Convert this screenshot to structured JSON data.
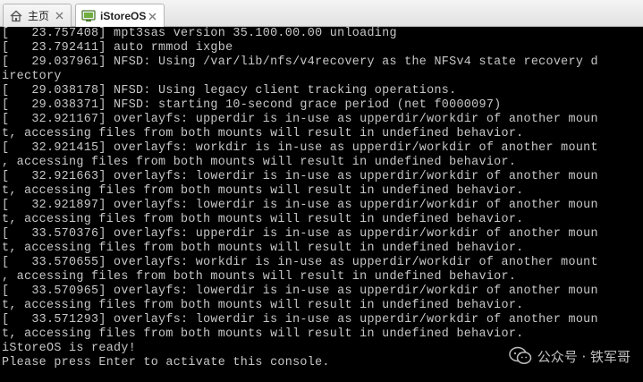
{
  "tabs": [
    {
      "label": "主页",
      "icon": "home-icon",
      "active": false
    },
    {
      "label": "iStoreOS",
      "icon": "vm-console-icon",
      "active": true
    }
  ],
  "console": {
    "lines": [
      "[   23.757408] mpt3sas version 35.100.00.00 unloading",
      "[   23.792411] auto rmmod ixgbe",
      "[   29.037961] NFSD: Using /var/lib/nfs/v4recovery as the NFSv4 state recovery d",
      "irectory",
      "[   29.038178] NFSD: Using legacy client tracking operations.",
      "[   29.038371] NFSD: starting 10-second grace period (net f0000097)",
      "[   32.921167] overlayfs: upperdir is in-use as upperdir/workdir of another moun",
      "t, accessing files from both mounts will result in undefined behavior.",
      "[   32.921415] overlayfs: workdir is in-use as upperdir/workdir of another mount",
      ", accessing files from both mounts will result in undefined behavior.",
      "[   32.921663] overlayfs: lowerdir is in-use as upperdir/workdir of another moun",
      "t, accessing files from both mounts will result in undefined behavior.",
      "[   32.921897] overlayfs: lowerdir is in-use as upperdir/workdir of another moun",
      "t, accessing files from both mounts will result in undefined behavior.",
      "[   33.570376] overlayfs: upperdir is in-use as upperdir/workdir of another moun",
      "t, accessing files from both mounts will result in undefined behavior.",
      "[   33.570655] overlayfs: workdir is in-use as upperdir/workdir of another mount",
      ", accessing files from both mounts will result in undefined behavior.",
      "[   33.570965] overlayfs: lowerdir is in-use as upperdir/workdir of another moun",
      "t, accessing files from both mounts will result in undefined behavior.",
      "[   33.571293] overlayfs: lowerdir is in-use as upperdir/workdir of another moun",
      "t, accessing files from both mounts will result in undefined behavior.",
      "iStoreOS is ready!",
      "Please press Enter to activate this console."
    ]
  },
  "watermark": {
    "text": "公众号 · 铁军哥",
    "icon": "wechat-icon"
  },
  "colors": {
    "console_bg": "#000000",
    "console_text": "#c7c7c7",
    "tabbar_bg": "#e8e8e8"
  }
}
